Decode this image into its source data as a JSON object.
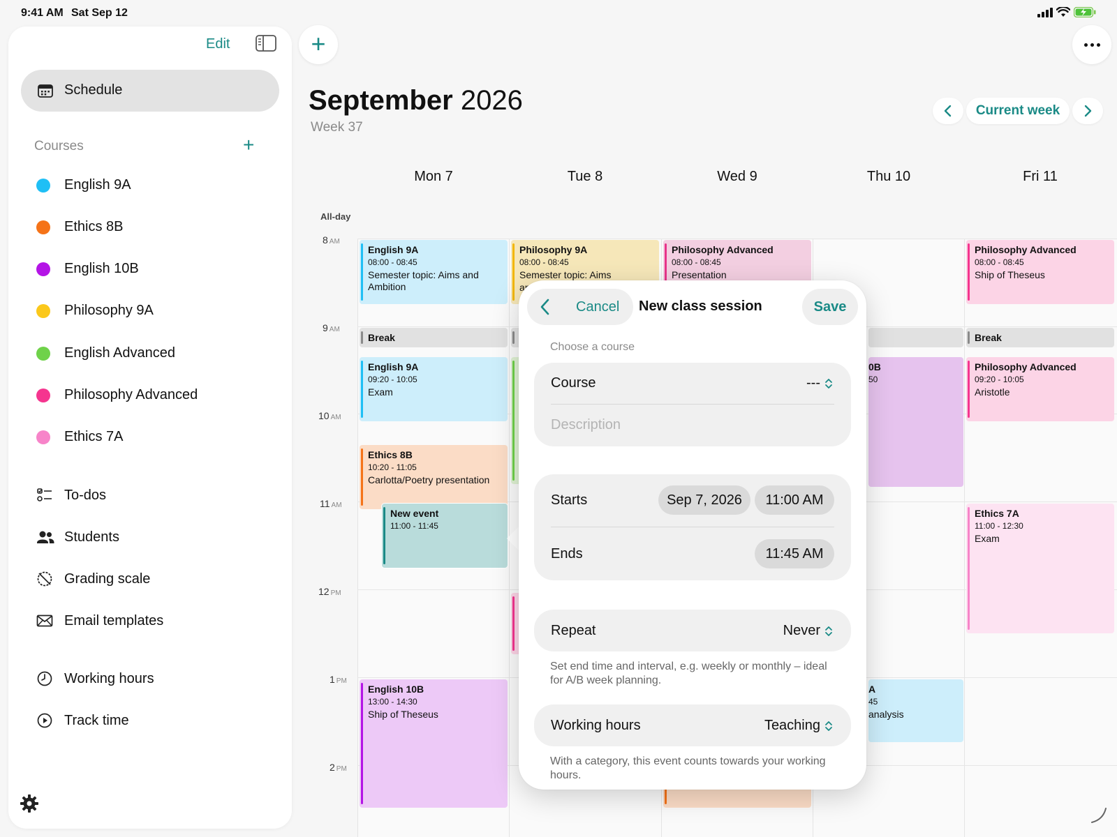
{
  "status_bar": {
    "time": "9:41 AM",
    "date": "Sat Sep 12"
  },
  "sidebar": {
    "edit_label": "Edit",
    "schedule_label": "Schedule",
    "courses_title": "Courses",
    "courses_add": "+",
    "courses": [
      {
        "label": "English 9A",
        "color": "#1fbff5"
      },
      {
        "label": "Ethics 8B",
        "color": "#f57318"
      },
      {
        "label": "English 10B",
        "color": "#b414e6"
      },
      {
        "label": "Philosophy 9A",
        "color": "#fbc81b"
      },
      {
        "label": "English Advanced",
        "color": "#6fd24a"
      },
      {
        "label": "Philosophy Advanced",
        "color": "#f5358f"
      },
      {
        "label": "Ethics 7A",
        "color": "#f784c9"
      }
    ],
    "nav": [
      {
        "label": "To-dos",
        "icon": "checklist-icon"
      },
      {
        "label": "Students",
        "icon": "students-icon"
      },
      {
        "label": "Grading scale",
        "icon": "grading-scale-icon"
      },
      {
        "label": "Email templates",
        "icon": "envelope-icon"
      },
      {
        "label": "Working hours",
        "icon": "clock-icon"
      },
      {
        "label": "Track time",
        "icon": "play-circle-icon"
      }
    ]
  },
  "header": {
    "add": "+",
    "title_month": "September",
    "title_year": "2026",
    "subtitle": "Week 37",
    "current_week_label": "Current week"
  },
  "calendar": {
    "days": [
      "Mon 7",
      "Tue 8",
      "Wed 9",
      "Thu 10",
      "Fri 11"
    ],
    "all_day_label": "All-day",
    "hours": [
      {
        "h": "8",
        "ap": "AM"
      },
      {
        "h": "9",
        "ap": "AM"
      },
      {
        "h": "10",
        "ap": "AM"
      },
      {
        "h": "11",
        "ap": "AM"
      },
      {
        "h": "12",
        "ap": "PM"
      },
      {
        "h": "1",
        "ap": "PM"
      },
      {
        "h": "2",
        "ap": "PM"
      }
    ],
    "events": {
      "mon_english9a_1": {
        "title": "English 9A",
        "time": "08:00 - 08:45",
        "desc": "Semester topic: Aims and Ambition"
      },
      "tue_philosophy9a": {
        "title": "Philosophy 9A",
        "time": "08:00 - 08:45",
        "desc": "Semester topic: Aims",
        "desc2": "an"
      },
      "wed_philadv": {
        "title": "Philosophy Advanced",
        "time": "08:00 - 08:45",
        "desc": "Presentation"
      },
      "fri_philadv_1": {
        "title": "Philosophy Advanced",
        "time": "08:00 - 08:45",
        "desc": "Ship of Theseus"
      },
      "mon_break": {
        "title": "Break"
      },
      "fri_break": {
        "title": "Break"
      },
      "mon_english9a_2": {
        "title": "English 9A",
        "time": "09:20 - 10:05",
        "desc": "Exam"
      },
      "thu_english10b": {
        "title": "0B",
        "time": "50"
      },
      "fri_philadv_2": {
        "title": "Philosophy Advanced",
        "time": "09:20 - 10:05",
        "desc": "Aristotle"
      },
      "mon_ethics8b": {
        "title": "Ethics 8B",
        "time": "10:20 - 11:05",
        "desc": "Carlotta/Poetry presentation"
      },
      "mon_new_event": {
        "title": "New event",
        "time": "11:00 - 11:45"
      },
      "fri_ethics7a": {
        "title": "Ethics 7A",
        "time": "11:00 - 12:30",
        "desc": "Exam"
      },
      "mon_english10b": {
        "title": "English 10B",
        "time": "13:00 - 14:30",
        "desc": "Ship of Theseus"
      },
      "thu_english9a": {
        "title": "A",
        "time": "45",
        "desc": "analysis"
      }
    }
  },
  "popover": {
    "cancel_label": "Cancel",
    "title": "New class session",
    "save_label": "Save",
    "section_title": "Choose a course",
    "course_label": "Course",
    "course_value": "---",
    "description_placeholder": "Description",
    "starts_label": "Starts",
    "starts_date": "Sep 7, 2026",
    "starts_time": "11:00 AM",
    "ends_label": "Ends",
    "ends_time": "11:45 AM",
    "repeat_label": "Repeat",
    "repeat_value": "Never",
    "repeat_help": "Set end time and interval, e.g. weekly or monthly – ideal for A/B week planning.",
    "working_hours_label": "Working hours",
    "working_hours_value": "Teaching",
    "working_hours_help": "With a category, this event counts towards your working hours."
  },
  "colors": {
    "accent": "#1a8a86"
  }
}
